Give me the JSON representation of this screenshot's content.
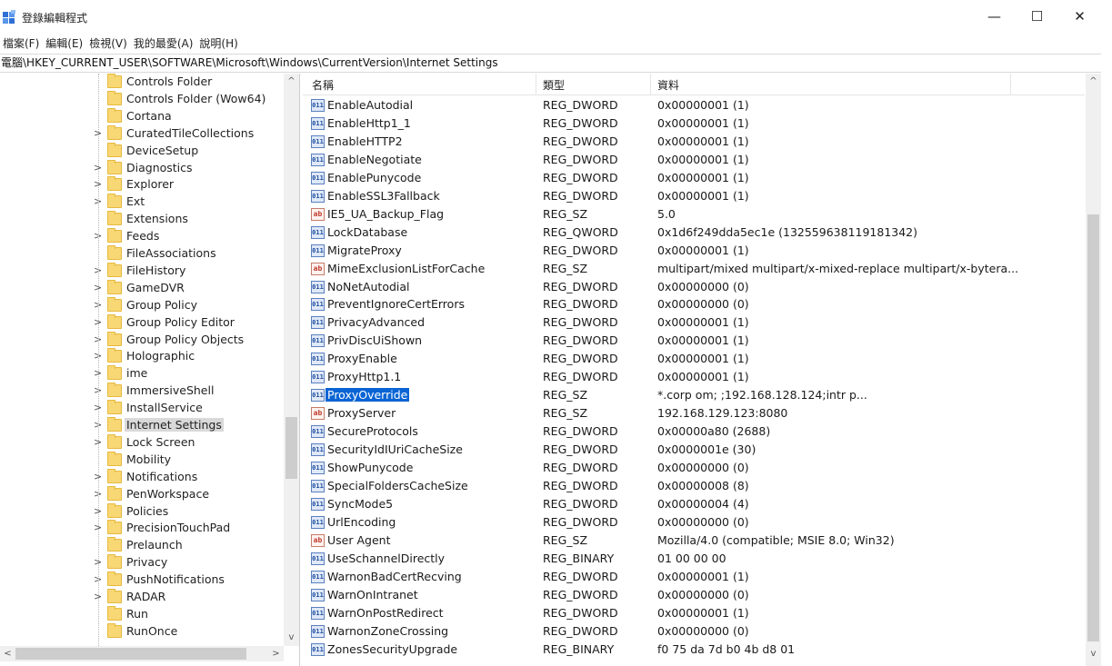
{
  "window": {
    "title": "登錄編輯程式",
    "min_glyph": "—",
    "max_glyph": "☐",
    "close_glyph": "✕"
  },
  "menu": [
    "檔案(F)",
    "編輯(E)",
    "檢視(V)",
    "我的最愛(A)",
    "說明(H)"
  ],
  "address": "電腦\\HKEY_CURRENT_USER\\SOFTWARE\\Microsoft\\Windows\\CurrentVersion\\Internet Settings",
  "tree": {
    "items": [
      {
        "label": "Controls Folder",
        "expander": ""
      },
      {
        "label": "Controls Folder (Wow64)",
        "expander": ""
      },
      {
        "label": "Cortana",
        "expander": ""
      },
      {
        "label": "CuratedTileCollections",
        "expander": ">"
      },
      {
        "label": "DeviceSetup",
        "expander": ""
      },
      {
        "label": "Diagnostics",
        "expander": ">"
      },
      {
        "label": "Explorer",
        "expander": ">"
      },
      {
        "label": "Ext",
        "expander": ">"
      },
      {
        "label": "Extensions",
        "expander": ""
      },
      {
        "label": "Feeds",
        "expander": ">"
      },
      {
        "label": "FileAssociations",
        "expander": ""
      },
      {
        "label": "FileHistory",
        "expander": ">"
      },
      {
        "label": "GameDVR",
        "expander": ">"
      },
      {
        "label": "Group Policy",
        "expander": ">"
      },
      {
        "label": "Group Policy Editor",
        "expander": ">"
      },
      {
        "label": "Group Policy Objects",
        "expander": ">"
      },
      {
        "label": "Holographic",
        "expander": ">"
      },
      {
        "label": "ime",
        "expander": ">"
      },
      {
        "label": "ImmersiveShell",
        "expander": ">"
      },
      {
        "label": "InstallService",
        "expander": ">"
      },
      {
        "label": "Internet Settings",
        "expander": ">",
        "selected": true
      },
      {
        "label": "Lock Screen",
        "expander": ">"
      },
      {
        "label": "Mobility",
        "expander": ""
      },
      {
        "label": "Notifications",
        "expander": ">"
      },
      {
        "label": "PenWorkspace",
        "expander": ">"
      },
      {
        "label": "Policies",
        "expander": ">"
      },
      {
        "label": "PrecisionTouchPad",
        "expander": ">"
      },
      {
        "label": "Prelaunch",
        "expander": ""
      },
      {
        "label": "Privacy",
        "expander": ">"
      },
      {
        "label": "PushNotifications",
        "expander": ">"
      },
      {
        "label": "RADAR",
        "expander": ">"
      },
      {
        "label": "Run",
        "expander": ""
      },
      {
        "label": "RunOnce",
        "expander": ""
      }
    ],
    "scroll_up": "^",
    "scroll_down": "v",
    "scroll_left": "<",
    "scroll_right": ">"
  },
  "list": {
    "columns": {
      "name": "名稱",
      "type": "類型",
      "data": "資料"
    },
    "scroll_up": "^",
    "scroll_down": "v",
    "rows": [
      {
        "icon": "reg-binary-icon",
        "name": "EnableAutodial",
        "type": "REG_DWORD",
        "data": "0x00000001 (1)"
      },
      {
        "icon": "reg-binary-icon",
        "name": "EnableHttp1_1",
        "type": "REG_DWORD",
        "data": "0x00000001 (1)"
      },
      {
        "icon": "reg-binary-icon",
        "name": "EnableHTTP2",
        "type": "REG_DWORD",
        "data": "0x00000001 (1)"
      },
      {
        "icon": "reg-binary-icon",
        "name": "EnableNegotiate",
        "type": "REG_DWORD",
        "data": "0x00000001 (1)"
      },
      {
        "icon": "reg-binary-icon",
        "name": "EnablePunycode",
        "type": "REG_DWORD",
        "data": "0x00000001 (1)"
      },
      {
        "icon": "reg-binary-icon",
        "name": "EnableSSL3Fallback",
        "type": "REG_DWORD",
        "data": "0x00000001 (1)"
      },
      {
        "icon": "reg-string-icon",
        "name": "IE5_UA_Backup_Flag",
        "type": "REG_SZ",
        "data": "5.0"
      },
      {
        "icon": "reg-binary-icon",
        "name": "LockDatabase",
        "type": "REG_QWORD",
        "data": "0x1d6f249dda5ec1e (132559638119181342)"
      },
      {
        "icon": "reg-binary-icon",
        "name": "MigrateProxy",
        "type": "REG_DWORD",
        "data": "0x00000001 (1)"
      },
      {
        "icon": "reg-string-icon",
        "name": "MimeExclusionListForCache",
        "type": "REG_SZ",
        "data": "multipart/mixed multipart/x-mixed-replace multipart/x-bytera..."
      },
      {
        "icon": "reg-binary-icon",
        "name": "NoNetAutodial",
        "type": "REG_DWORD",
        "data": "0x00000000 (0)"
      },
      {
        "icon": "reg-binary-icon",
        "name": "PreventIgnoreCertErrors",
        "type": "REG_DWORD",
        "data": "0x00000000 (0)"
      },
      {
        "icon": "reg-binary-icon",
        "name": "PrivacyAdvanced",
        "type": "REG_DWORD",
        "data": "0x00000001 (1)"
      },
      {
        "icon": "reg-binary-icon",
        "name": "PrivDiscUiShown",
        "type": "REG_DWORD",
        "data": "0x00000001 (1)"
      },
      {
        "icon": "reg-binary-icon",
        "name": "ProxyEnable",
        "type": "REG_DWORD",
        "data": "0x00000001 (1)"
      },
      {
        "icon": "reg-binary-icon",
        "name": "ProxyHttp1.1",
        "type": "REG_DWORD",
        "data": "0x00000001 (1)"
      },
      {
        "icon": "reg-binary-icon",
        "name": "ProxyOverride",
        "type": "REG_SZ",
        "data": "*.corp          om;              ;192.168.128.124;intr           p...",
        "selected": true
      },
      {
        "icon": "reg-string-icon",
        "name": "ProxyServer",
        "type": "REG_SZ",
        "data": "192.168.129.123:8080"
      },
      {
        "icon": "reg-binary-icon",
        "name": "SecureProtocols",
        "type": "REG_DWORD",
        "data": "0x00000a80 (2688)"
      },
      {
        "icon": "reg-binary-icon",
        "name": "SecurityIdIUriCacheSize",
        "type": "REG_DWORD",
        "data": "0x0000001e (30)"
      },
      {
        "icon": "reg-binary-icon",
        "name": "ShowPunycode",
        "type": "REG_DWORD",
        "data": "0x00000000 (0)"
      },
      {
        "icon": "reg-binary-icon",
        "name": "SpecialFoldersCacheSize",
        "type": "REG_DWORD",
        "data": "0x00000008 (8)"
      },
      {
        "icon": "reg-binary-icon",
        "name": "SyncMode5",
        "type": "REG_DWORD",
        "data": "0x00000004 (4)"
      },
      {
        "icon": "reg-binary-icon",
        "name": "UrlEncoding",
        "type": "REG_DWORD",
        "data": "0x00000000 (0)"
      },
      {
        "icon": "reg-string-icon",
        "name": "User Agent",
        "type": "REG_SZ",
        "data": "Mozilla/4.0 (compatible; MSIE 8.0; Win32)"
      },
      {
        "icon": "reg-binary-icon",
        "name": "UseSchannelDirectly",
        "type": "REG_BINARY",
        "data": "01 00 00 00"
      },
      {
        "icon": "reg-binary-icon",
        "name": "WarnonBadCertRecving",
        "type": "REG_DWORD",
        "data": "0x00000001 (1)"
      },
      {
        "icon": "reg-binary-icon",
        "name": "WarnOnIntranet",
        "type": "REG_DWORD",
        "data": "0x00000000 (0)"
      },
      {
        "icon": "reg-binary-icon",
        "name": "WarnOnPostRedirect",
        "type": "REG_DWORD",
        "data": "0x00000001 (1)"
      },
      {
        "icon": "reg-binary-icon",
        "name": "WarnonZoneCrossing",
        "type": "REG_DWORD",
        "data": "0x00000000 (0)"
      },
      {
        "icon": "reg-binary-icon",
        "name": "ZonesSecurityUpgrade",
        "type": "REG_BINARY",
        "data": "f0 75 da 7d b0 4b d8 01"
      }
    ]
  }
}
